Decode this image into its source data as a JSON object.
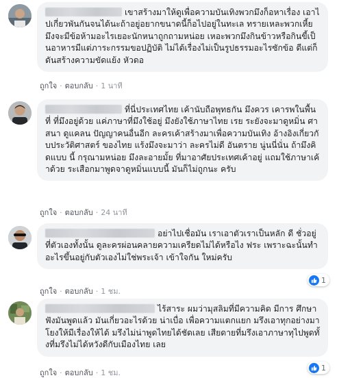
{
  "colors": {
    "bubble": "#f2f3f5",
    "link": "#4b4f56",
    "like_blue": "#1877f2"
  },
  "comments": [
    {
      "avatar_icon": "user-avatar-icon",
      "text": "เขาสร้างมาให้ดูเพื่อความบันเทิงพวกมึงก็อหาเรื่อง เอาไปเกี่ยวพันกันจนได้นะถ้าอยู่อยากขนาดนี้ก็อไปอยู่ในทะเล ทรายเหละพวกเหี้ย มึงจะมีข้อห้ามอะไรเยอะนักหนาถูกถามหน่อย เหอะพวกมึงกินข้าวหรือกินขี้เป็นอาหารมีแต่ภาระกรรมขอปฏิบัติ ไม่ได้เรื่องไม่เป็นรูปธรรมอะไรซักข้อ ดีแต่ก็ดันสร้างความขัดแย้ง หัวดอ",
      "like": "ถูกใจ",
      "reply": "ตอบกลับ",
      "time": "1 นาที",
      "reactions": null
    },
    {
      "avatar_icon": "user-avatar-icon",
      "text": "ที่นี่ประเทศไทย เค้านับถือพุทธกัน มึงควร เคารพในพื้นที่ ที่มึงอยู่ด้วย แค่ภาษาที่มึงใช้อยู่ มึงยังใช้ภาษาไทย เรย ระยังจะมาดูหมิ่น ศาสนา ดูแคลน ปัญญาคนอื่นอีก ละครเค้าสร้างมาเพื่อความบันเทิง อ้างอิงเกี่ยวกับประวัติศาสตร์ ของไทย แร้งมึงจะมาว่า ละครไม่ดี อันตราย นู่นนี่นั่น ถ้ามึงคิดแบบ นี้ กรุณามหน่อย มึงละอายมั้ย ที่มาอาศัยประเทศเค้าอยู่ แถมใช้ภาษาเค้าด้วย ระเสือกมาพูดจาดูหมิ่นแบบนี้ มันก็ไม่ถูกนะ ครับ",
      "like": "ถูกใจ",
      "reply": "ตอบกลับ",
      "time": "24 นาที",
      "reactions": null
    },
    {
      "avatar_icon": "user-avatar-icon",
      "text": "อย่าไปเชื่อมัน เราเอาตัวเราเป็นหลัก ดี ชั่วอยู่ที่ตัวเองทั้งนั้น ดูละครผ่อนคลายความเครียดไม่ได้หรือไง ฟระ เพราะฉะนั้นทำอะไรขึ้นอยู่กับตัวเองไม่ใช่พระเจ้า เข้าใจกัน ใหม่ครับ",
      "like": "ถูกใจ",
      "reply": "ตอบกลับ",
      "time": "1 ชม.",
      "reactions": "1"
    },
    {
      "avatar_icon": "user-avatar-icon",
      "text": "ไร้สาระ ผมว่ามุสลิมที่มีความคิด มีการ ศึกษาฟังมันพูดแล้ว มันเกี่ยวอะไรด้วย น่าเบื่อ เพื่อความแตกแยก มรึงเอาทุกอย่างมาโยงให้มีเรื่องให้ได้ มรึงไม่น่าพูดไทยได้ชัดเลย เสียดายที่มรึงเอาภาษาทุไปพูดทั้งที่มรึงไม่ได้หวังดีกับเมืองไทย เลย",
      "like": "ถูกใจ",
      "reply": "ตอบกลับ",
      "time": "1 ชม.",
      "reactions": "1"
    }
  ]
}
